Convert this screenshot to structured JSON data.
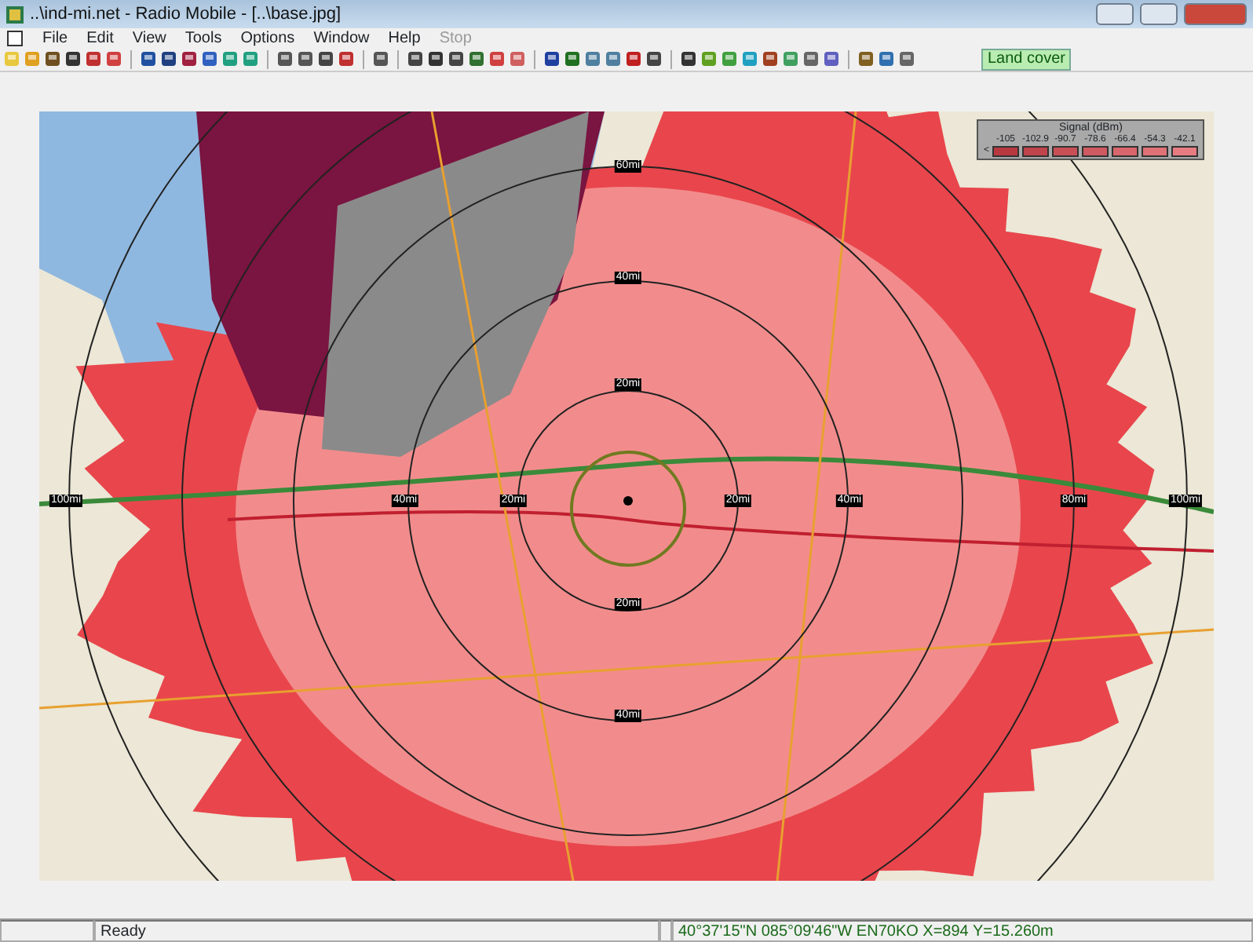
{
  "window": {
    "title": "..\\ind-mi.net - Radio Mobile - [..\\base.jpg]"
  },
  "menu": [
    {
      "label": "File",
      "disabled": false
    },
    {
      "label": "Edit",
      "disabled": false
    },
    {
      "label": "View",
      "disabled": false
    },
    {
      "label": "Tools",
      "disabled": false
    },
    {
      "label": "Options",
      "disabled": false
    },
    {
      "label": "Window",
      "disabled": false
    },
    {
      "label": "Help",
      "disabled": false
    },
    {
      "label": "Stop",
      "disabled": true
    }
  ],
  "toolbar": {
    "land_cover_button": "Land cover"
  },
  "map": {
    "range_labels": [
      "60mi",
      "40mi",
      "20mi",
      "20mi",
      "40mi",
      "100mi",
      "40mi",
      "20mi",
      "20mi",
      "40mi",
      "80mi",
      "100mi"
    ],
    "legend": {
      "title": "Signal (dBm)",
      "below_label": "<",
      "steps": [
        {
          "label": "-105",
          "color": "#b8383f"
        },
        {
          "label": "-102.9",
          "color": "#c0444b"
        },
        {
          "label": "-90.7",
          "color": "#c84f56"
        },
        {
          "label": "-78.6",
          "color": "#d05a61"
        },
        {
          "label": "-66.4",
          "color": "#d8666c"
        },
        {
          "label": "-54.3",
          "color": "#df7177"
        },
        {
          "label": "-42.1",
          "color": "#e67c82"
        }
      ]
    }
  },
  "status_bar": {
    "message": "Ready",
    "coordinates": "40°37'15\"N 085°09'46\"W  EN70KO  X=894 Y=15.260m"
  }
}
